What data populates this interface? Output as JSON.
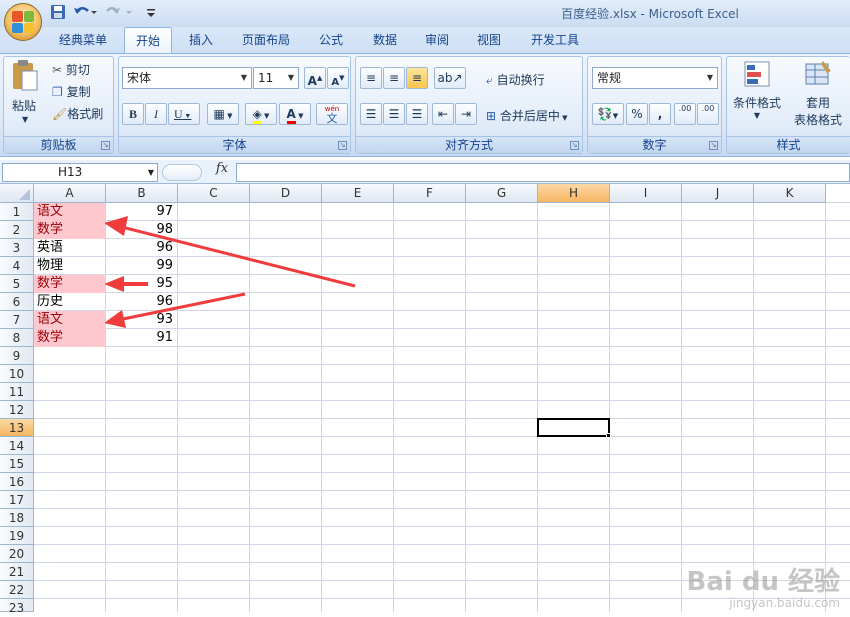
{
  "window": {
    "title": "百度经验.xlsx - Microsoft Excel"
  },
  "tabs": [
    {
      "label": "经典菜单",
      "active": false
    },
    {
      "label": "开始",
      "active": true
    },
    {
      "label": "插入",
      "active": false
    },
    {
      "label": "页面布局",
      "active": false
    },
    {
      "label": "公式",
      "active": false
    },
    {
      "label": "数据",
      "active": false
    },
    {
      "label": "审阅",
      "active": false
    },
    {
      "label": "视图",
      "active": false
    },
    {
      "label": "开发工具",
      "active": false
    }
  ],
  "ribbon": {
    "clipboard": {
      "label": "剪贴板",
      "paste": "粘贴",
      "cut": "剪切",
      "copy": "复制",
      "format_painter": "格式刷"
    },
    "font": {
      "label": "字体",
      "font_name": "宋体",
      "font_size": "11",
      "bold": "B",
      "italic": "I",
      "underline": "U",
      "font_color_glyph": "A",
      "grow_glyph": "A",
      "shrink_glyph": "A",
      "phonetic_glyph": "文",
      "phonetic_top": "wén"
    },
    "alignment": {
      "label": "对齐方式",
      "wrap_text": "自动换行",
      "merge_center": "合并后居中"
    },
    "number": {
      "label": "数字",
      "format": "常规",
      "percent": "%",
      "comma": ",",
      "inc_decimal": ".00",
      "dec_decimal": ".00"
    },
    "styles": {
      "label": "样式",
      "conditional": "条件格式",
      "table_format_1": "套用",
      "table_format_2": "表格格式"
    }
  },
  "formula_bar": {
    "name_box": "H13",
    "fx": "fx",
    "value": ""
  },
  "columns": [
    "A",
    "B",
    "C",
    "D",
    "E",
    "F",
    "G",
    "H",
    "I",
    "J",
    "K"
  ],
  "selected_column": "H",
  "selected_row": 13,
  "rows": [
    "1",
    "2",
    "3",
    "4",
    "5",
    "6",
    "7",
    "8",
    "9",
    "10",
    "11",
    "12",
    "13",
    "14",
    "15",
    "16",
    "17",
    "18",
    "19",
    "20",
    "21",
    "22",
    "23"
  ],
  "cells": [
    {
      "row": 1,
      "a": "语文",
      "b": "97",
      "highlight": true
    },
    {
      "row": 2,
      "a": "数学",
      "b": "98",
      "highlight": true
    },
    {
      "row": 3,
      "a": "英语",
      "b": "96",
      "highlight": false
    },
    {
      "row": 4,
      "a": "物理",
      "b": "99",
      "highlight": false
    },
    {
      "row": 5,
      "a": "数学",
      "b": "95",
      "highlight": true
    },
    {
      "row": 6,
      "a": "历史",
      "b": "96",
      "highlight": false
    },
    {
      "row": 7,
      "a": "语文",
      "b": "93",
      "highlight": true
    },
    {
      "row": 8,
      "a": "数学",
      "b": "91",
      "highlight": true
    }
  ],
  "colors": {
    "highlight_fill": "#ffc7ce",
    "highlight_text": "#9c0006",
    "arrow": "#f03c3c",
    "selection_header": "#f7b561"
  },
  "watermark": {
    "brand": "Bai du 经验",
    "url": "jingyan.baidu.com"
  }
}
